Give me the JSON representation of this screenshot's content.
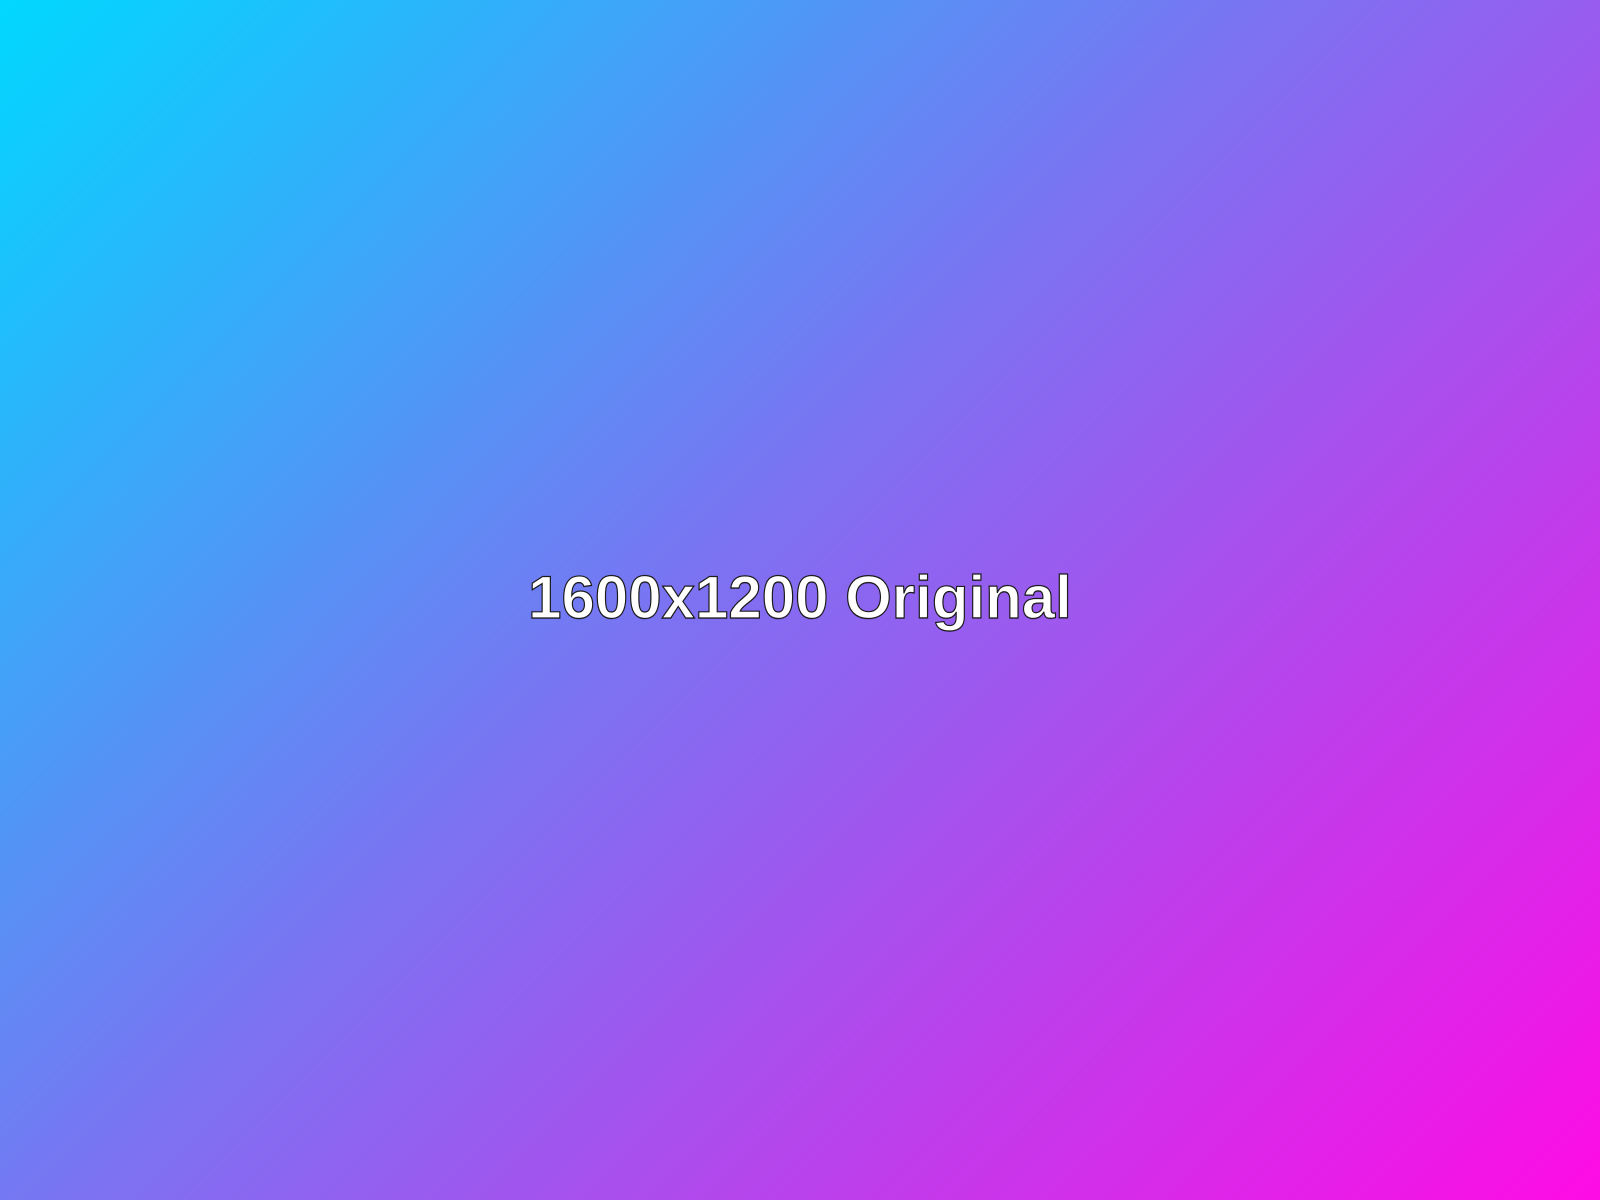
{
  "canvas": {
    "label": "1600x1200 Original",
    "gradient": {
      "start_color": "#00d8ff",
      "mid_color": "#7a74f2",
      "end_color": "#ff0be5",
      "direction": "top-left to bottom-right"
    },
    "text_color": "#ffffff",
    "text_outline_color": "#1b1b1b"
  }
}
